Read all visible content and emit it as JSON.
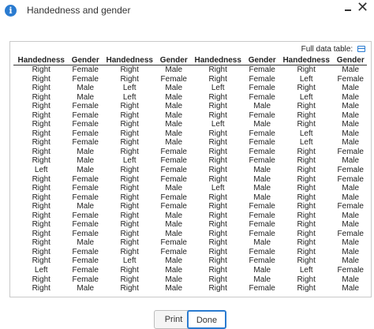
{
  "window": {
    "title": "Handedness and gender",
    "info_icon": "info-icon",
    "minimize_icon": "minimize-icon",
    "close_icon": "close-icon"
  },
  "full_data": {
    "label": "Full data table:",
    "icon": "table-icon"
  },
  "table": {
    "headers": [
      "Handedness",
      "Gender",
      "Handedness",
      "Gender",
      "Handedness",
      "Gender",
      "Handedness",
      "Gender"
    ],
    "rows": [
      [
        "Right",
        "Female",
        "Right",
        "Male",
        "Right",
        "Female",
        "Right",
        "Male"
      ],
      [
        "Right",
        "Female",
        "Right",
        "Female",
        "Right",
        "Female",
        "Left",
        "Female"
      ],
      [
        "Right",
        "Male",
        "Left",
        "Male",
        "Left",
        "Female",
        "Right",
        "Male"
      ],
      [
        "Right",
        "Male",
        "Left",
        "Male",
        "Right",
        "Female",
        "Left",
        "Male"
      ],
      [
        "Right",
        "Female",
        "Right",
        "Male",
        "Right",
        "Male",
        "Right",
        "Male"
      ],
      [
        "Right",
        "Female",
        "Right",
        "Male",
        "Right",
        "Female",
        "Right",
        "Male"
      ],
      [
        "Right",
        "Female",
        "Right",
        "Male",
        "Left",
        "Male",
        "Right",
        "Male"
      ],
      [
        "Right",
        "Female",
        "Right",
        "Male",
        "Right",
        "Female",
        "Left",
        "Male"
      ],
      [
        "Right",
        "Female",
        "Right",
        "Male",
        "Right",
        "Female",
        "Left",
        "Male"
      ],
      [
        "Right",
        "Male",
        "Right",
        "Female",
        "Right",
        "Female",
        "Right",
        "Female"
      ],
      [
        "Right",
        "Male",
        "Left",
        "Female",
        "Right",
        "Female",
        "Right",
        "Male"
      ],
      [
        "Left",
        "Male",
        "Right",
        "Female",
        "Right",
        "Male",
        "Right",
        "Female"
      ],
      [
        "Right",
        "Female",
        "Right",
        "Female",
        "Right",
        "Male",
        "Right",
        "Female"
      ],
      [
        "Right",
        "Female",
        "Right",
        "Male",
        "Left",
        "Male",
        "Right",
        "Male"
      ],
      [
        "Right",
        "Female",
        "Right",
        "Female",
        "Right",
        "Male",
        "Right",
        "Male"
      ],
      [
        "Right",
        "Male",
        "Right",
        "Female",
        "Right",
        "Female",
        "Right",
        "Female"
      ],
      [
        "Right",
        "Female",
        "Right",
        "Male",
        "Right",
        "Female",
        "Right",
        "Male"
      ],
      [
        "Right",
        "Female",
        "Right",
        "Male",
        "Right",
        "Female",
        "Right",
        "Male"
      ],
      [
        "Right",
        "Female",
        "Right",
        "Male",
        "Right",
        "Female",
        "Right",
        "Female"
      ],
      [
        "Right",
        "Male",
        "Right",
        "Female",
        "Right",
        "Male",
        "Right",
        "Male"
      ],
      [
        "Right",
        "Female",
        "Right",
        "Female",
        "Right",
        "Female",
        "Right",
        "Male"
      ],
      [
        "Right",
        "Female",
        "Left",
        "Male",
        "Right",
        "Female",
        "Right",
        "Male"
      ],
      [
        "Left",
        "Female",
        "Right",
        "Male",
        "Right",
        "Male",
        "Left",
        "Female"
      ],
      [
        "Right",
        "Female",
        "Right",
        "Male",
        "Right",
        "Male",
        "Right",
        "Male"
      ],
      [
        "Right",
        "Male",
        "Right",
        "Male",
        "Right",
        "Female",
        "Right",
        "Male"
      ]
    ]
  },
  "buttons": {
    "print": "Print",
    "done": "Done"
  },
  "colors": {
    "accent": "#2a7bd0"
  }
}
